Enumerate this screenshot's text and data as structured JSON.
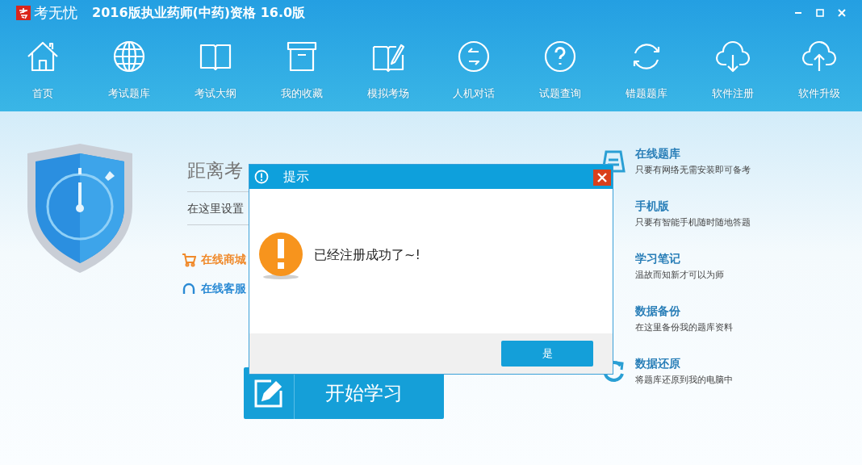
{
  "window": {
    "logo_text": "考无忧",
    "title": "2016版执业药师(中药)资格 16.0版"
  },
  "nav": [
    {
      "label": "首页"
    },
    {
      "label": "考试题库"
    },
    {
      "label": "考试大纲"
    },
    {
      "label": "我的收藏"
    },
    {
      "label": "模拟考场"
    },
    {
      "label": "人机对话"
    },
    {
      "label": "试题查询"
    },
    {
      "label": "错题题库"
    },
    {
      "label": "软件注册"
    },
    {
      "label": "软件升级"
    }
  ],
  "countdown": {
    "text": "距离考"
  },
  "exam_date": {
    "text": "在这里设置"
  },
  "links": [
    {
      "kind": "shop",
      "label": "在线商城"
    },
    {
      "kind": "service",
      "label": "在线客服"
    }
  ],
  "start_button": {
    "label": "开始学习"
  },
  "features": [
    {
      "kind": "online",
      "title": "在线题库",
      "subtitle": "只要有网络无需安装即可备考"
    },
    {
      "kind": "mobile",
      "title": "手机版",
      "subtitle": "只要有智能手机随时随地答题"
    },
    {
      "kind": "notes",
      "title": "学习笔记",
      "subtitle": "温故而知新才可以为师"
    },
    {
      "kind": "backup",
      "title": "数据备份",
      "subtitle": "在这里备份我的题库资料"
    },
    {
      "kind": "restore",
      "title": "数据还原",
      "subtitle": "将题库还原到我的电脑中"
    }
  ],
  "dialog": {
    "title": "提示",
    "message": "已经注册成功了~!",
    "button": "是"
  }
}
